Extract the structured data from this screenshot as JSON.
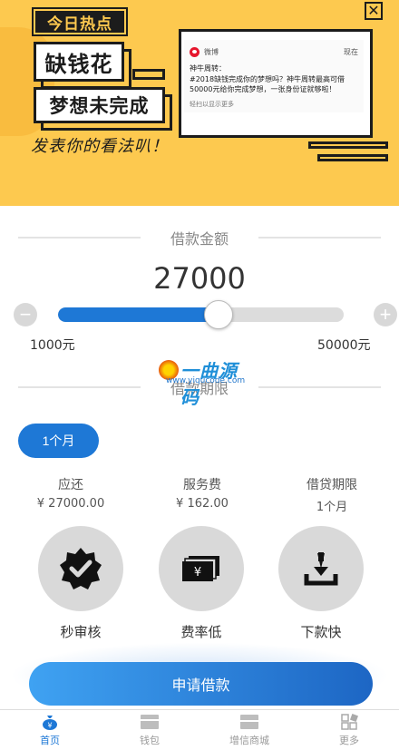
{
  "banner": {
    "hot_tag": "今日热点",
    "headline1": "缺钱花",
    "headline2": "梦想未完成",
    "slogan": "发表你的看法叭！",
    "close_label": "✕",
    "notification": {
      "app": "微博",
      "time": "现在",
      "title": "神牛周转：",
      "body": "#2018缺钱完成你的梦想吗？神牛周转最高可借50000元给你完成梦想，一张身份证就够啦！",
      "more": "轻扫以显示更多"
    }
  },
  "loan": {
    "amount_title": "借款金额",
    "amount": "27000",
    "amount_value": 27000,
    "min_label": "1000元",
    "max_label": "50000元",
    "min_value": 1000,
    "max_value": 50000,
    "minus_label": "−",
    "plus_label": "+",
    "term_title": "借款期限",
    "term_option": "1个月",
    "watermark_text": "一曲源码",
    "watermark_url": "www.yiqucode.com"
  },
  "summary": [
    {
      "label": "应还",
      "value": "¥ 27000.00"
    },
    {
      "label": "服务费",
      "value": "¥ 162.00"
    },
    {
      "label": "借贷期限",
      "value": "1个月"
    }
  ],
  "features": [
    {
      "icon": "badge-check-icon",
      "label": "秒审核"
    },
    {
      "icon": "money-icon",
      "label": "费率低"
    },
    {
      "icon": "download-icon",
      "label": "下款快"
    }
  ],
  "apply_label": "申请借款",
  "tabs": [
    {
      "icon": "money-bag-icon",
      "label": "首页",
      "active": true
    },
    {
      "icon": "wallet-icon",
      "label": "钱包",
      "active": false
    },
    {
      "icon": "shop-icon",
      "label": "增信商城",
      "active": false
    },
    {
      "icon": "more-grid-icon",
      "label": "更多",
      "active": false
    }
  ],
  "colors": {
    "accent": "#1e78d6",
    "banner": "#fdc94f"
  }
}
